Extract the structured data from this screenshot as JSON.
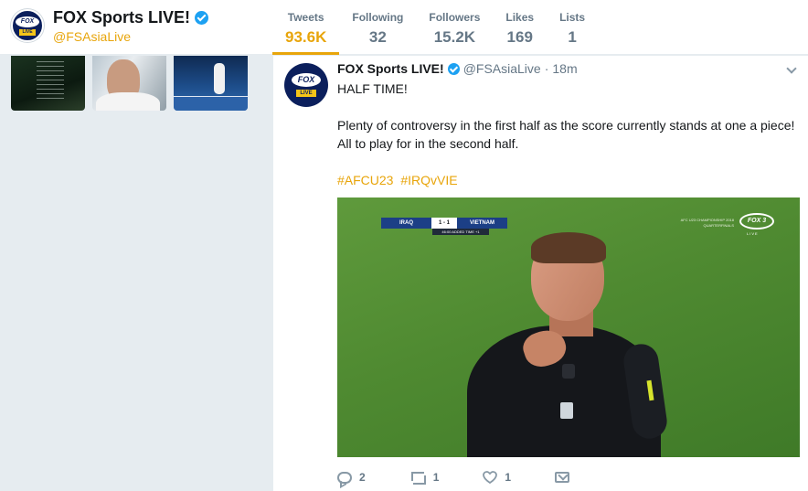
{
  "profile": {
    "name": "FOX Sports LIVE!",
    "handle": "@FSAsiaLive",
    "avatar_logo_text": "FOX",
    "avatar_badge_text": "LIVE",
    "verified_icon": "verified-badge-icon"
  },
  "stats": [
    {
      "label": "Tweets",
      "value": "93.6K",
      "active": true
    },
    {
      "label": "Following",
      "value": "32",
      "active": false
    },
    {
      "label": "Followers",
      "value": "15.2K",
      "active": false
    },
    {
      "label": "Likes",
      "value": "169",
      "active": false
    },
    {
      "label": "Lists",
      "value": "1",
      "active": false
    }
  ],
  "tweet": {
    "author": "FOX Sports LIVE!",
    "handle": "@FSAsiaLive",
    "separator": "·",
    "time": "18m",
    "text_line1": "HALF TIME!",
    "text_line2": "Plenty of controversy in the first half as the score currently stands at one a piece! All to play for in the second half.",
    "hashtags": [
      "#AFCU23",
      "#IRQvVIE"
    ],
    "media": {
      "team_home": "IRAQ",
      "score": "1 - 1",
      "team_away": "VIETNAM",
      "clock": "46:00  ADDED TIME  +1",
      "caption": "AFC U23 CHAMPIONSHIP 2018 QUARTERFINALS",
      "channel_logo": "FOX 3",
      "channel_sub": "LIVE"
    },
    "actions": {
      "reply_count": "2",
      "retweet_count": "1",
      "like_count": "1"
    }
  },
  "colors": {
    "accent": "#e8a50b",
    "verified": "#1da1f2",
    "muted": "#657786",
    "background": "#e6ecf0"
  }
}
